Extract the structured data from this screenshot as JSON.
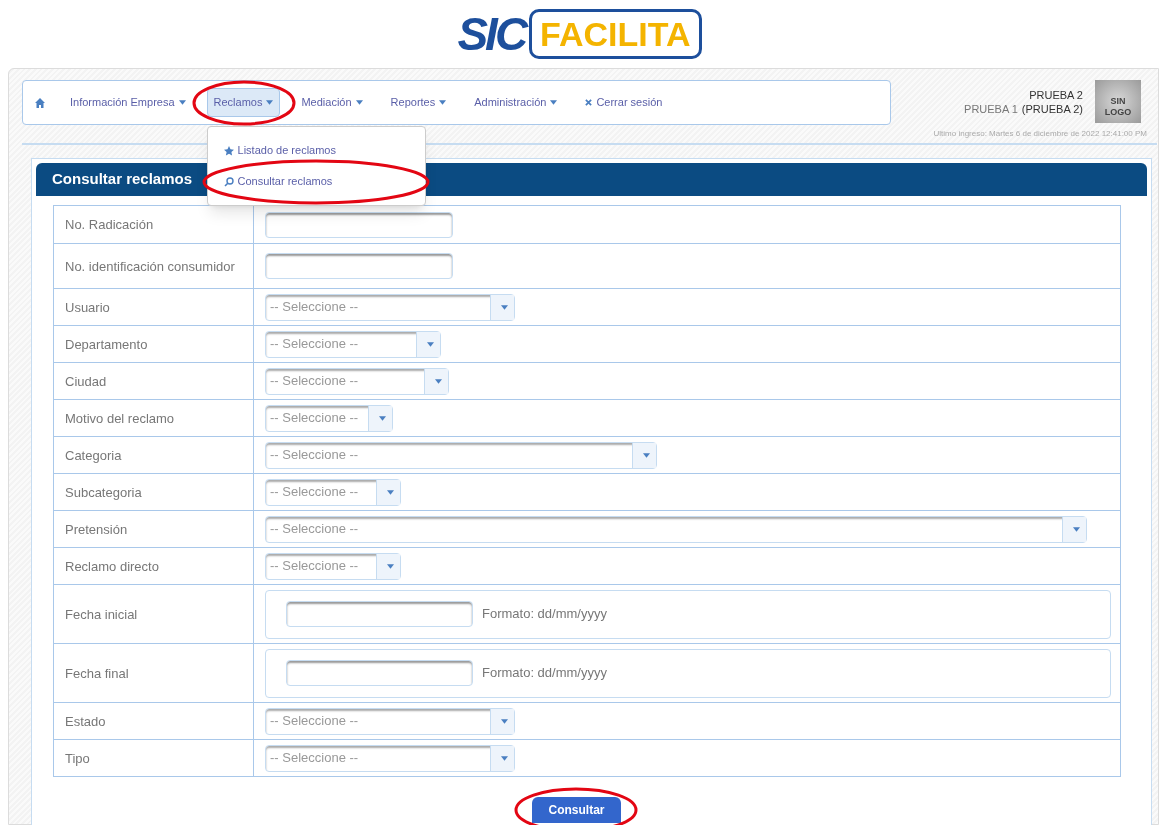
{
  "logo": {
    "left": "SIC",
    "right": "FACILITA"
  },
  "nav": [
    {
      "kind": "home"
    },
    {
      "kind": "menu",
      "label": "Información Empresa",
      "circled": false,
      "selected": false
    },
    {
      "kind": "menu",
      "label": "Reclamos",
      "circled": true,
      "selected": true
    },
    {
      "kind": "menu",
      "label": "Mediación",
      "circled": false,
      "selected": false
    },
    {
      "kind": "menu",
      "label": "Reportes",
      "circled": false,
      "selected": false
    },
    {
      "kind": "menu",
      "label": "Administración",
      "circled": false,
      "selected": false
    },
    {
      "kind": "logout",
      "label": "Cerrar sesión",
      "circled": false
    }
  ],
  "dropdown": [
    {
      "kind": "list",
      "label": "Listado de reclamos",
      "circled": false
    },
    {
      "kind": "query",
      "label": "Consultar reclamos",
      "circled": true
    }
  ],
  "user": {
    "name": "PRUEBA 2",
    "company": "PRUEBA 1",
    "company_strong": "(PRUEBA 2)",
    "logo": [
      "SIN",
      "LOGO"
    ],
    "last_login": "Ultimo ingreso: Martes 6 de diciembre de 2022 12:41:00 PM"
  },
  "form": {
    "title": "Consultar reclamos",
    "rows": [
      {
        "kind": "text",
        "label": "No. Radicación"
      },
      {
        "kind": "text",
        "label": "No. identificación consumidor"
      },
      {
        "kind": "select",
        "label": "Usuario",
        "placeholder": "-- Seleccione --"
      },
      {
        "kind": "select",
        "label": "Departamento",
        "placeholder": "-- Seleccione --"
      },
      {
        "kind": "select",
        "label": "Ciudad",
        "placeholder": "-- Seleccione --"
      },
      {
        "kind": "select",
        "label": "Motivo del reclamo",
        "placeholder": "-- Seleccione --"
      },
      {
        "kind": "select",
        "label": "Categoria",
        "placeholder": "-- Seleccione --"
      },
      {
        "kind": "select",
        "label": "Subcategoria",
        "placeholder": "-- Seleccione --"
      },
      {
        "kind": "select",
        "label": "Pretensión",
        "placeholder": "-- Seleccione --"
      },
      {
        "kind": "select",
        "label": "Reclamo directo",
        "placeholder": "-- Seleccione --"
      },
      {
        "kind": "date",
        "label": "Fecha inicial",
        "hint": "Formato: dd/mm/yyyy"
      },
      {
        "kind": "date",
        "label": "Fecha final",
        "hint": "Formato: dd/mm/yyyy"
      },
      {
        "kind": "select",
        "label": "Estado",
        "placeholder": "-- Seleccione --"
      },
      {
        "kind": "select",
        "label": "Tipo",
        "placeholder": "-- Seleccione --"
      }
    ],
    "submit": {
      "label": "Consultar",
      "circled": true
    }
  }
}
